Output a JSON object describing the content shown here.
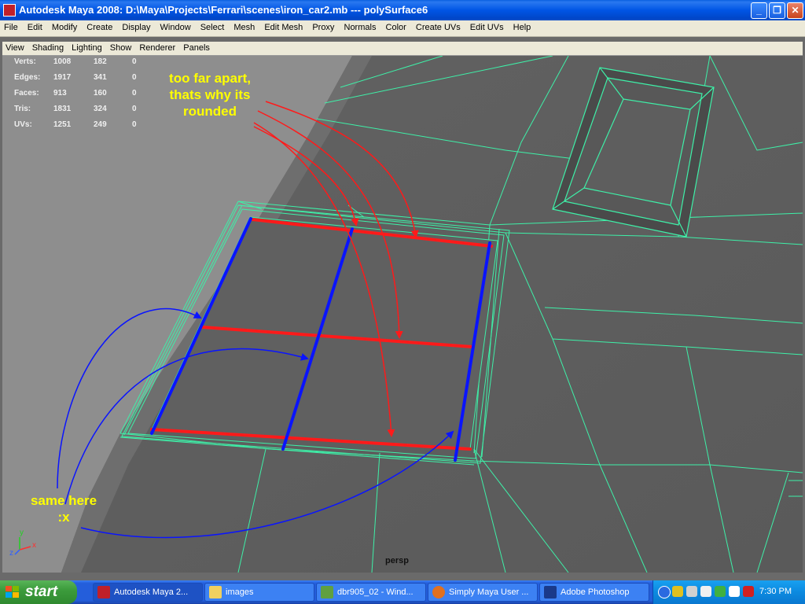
{
  "window": {
    "title": "Autodesk Maya 2008: D:\\Maya\\Projects\\Ferrari\\scenes\\iron_car2.mb   ---   polySurface6",
    "buttons": {
      "minimize": "_",
      "maximize": "❐",
      "close": "✕"
    }
  },
  "menu": [
    "File",
    "Edit",
    "Modify",
    "Create",
    "Display",
    "Window",
    "Select",
    "Mesh",
    "Edit Mesh",
    "Proxy",
    "Normals",
    "Color",
    "Create UVs",
    "Edit UVs",
    "Help"
  ],
  "panel_menu": [
    "View",
    "Shading",
    "Lighting",
    "Show",
    "Renderer",
    "Panels"
  ],
  "hud": [
    {
      "label": "Verts:",
      "a": "1008",
      "b": "182",
      "c": "0"
    },
    {
      "label": "Edges:",
      "a": "1917",
      "b": "341",
      "c": "0"
    },
    {
      "label": "Faces:",
      "a": "913",
      "b": "160",
      "c": "0"
    },
    {
      "label": "Tris:",
      "a": "1831",
      "b": "324",
      "c": "0"
    },
    {
      "label": "UVs:",
      "a": "1251",
      "b": "249",
      "c": "0"
    }
  ],
  "annotations": {
    "top": [
      "too far apart,",
      "thats why its",
      "rounded"
    ],
    "bottom": [
      "same here",
      ":x"
    ]
  },
  "camera_label": "persp",
  "axis": {
    "y": "y",
    "x": "x",
    "z": "z"
  },
  "colors": {
    "wire": "#3ef0a8",
    "red_edge": "#ff1a1a",
    "blue_edge": "#0a14ff",
    "annotation": "#ffff00"
  },
  "taskbar": {
    "start": "start",
    "tasks": [
      {
        "label": "Autodesk Maya 2...",
        "icon": "maya-icon"
      },
      {
        "label": "images",
        "icon": "folder-icon"
      },
      {
        "label": "dbr905_02 - Wind...",
        "icon": "image-viewer-icon"
      },
      {
        "label": "Simply Maya User ...",
        "icon": "firefox-icon"
      },
      {
        "label": "Adobe Photoshop",
        "icon": "photoshop-icon"
      }
    ],
    "clock": "7:30 PM"
  }
}
